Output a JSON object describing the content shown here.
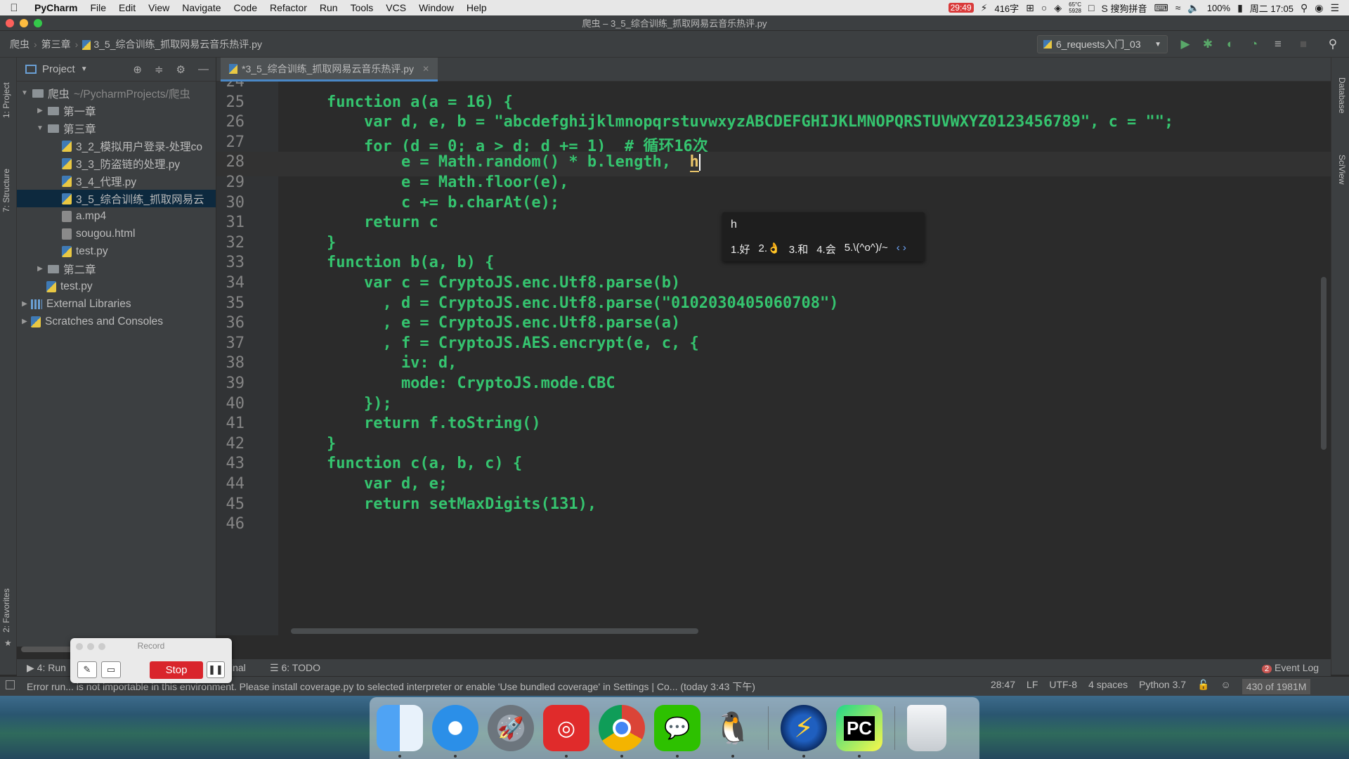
{
  "menubar": {
    "app": "PyCharm",
    "items": [
      "File",
      "Edit",
      "View",
      "Navigate",
      "Code",
      "Refactor",
      "Run",
      "Tools",
      "VCS",
      "Window",
      "Help"
    ],
    "record_time": "29:49",
    "word_count": "416字",
    "temp_top": "65°C",
    "temp_bottom": "5928",
    "ime_name": "搜狗拼音",
    "battery": "100%",
    "clock": "周二 17:05"
  },
  "window": {
    "title": "爬虫 – 3_5_综合训练_抓取网易云音乐热评.py"
  },
  "navbar": {
    "crumbs": [
      "爬虫",
      "第三章",
      "3_5_综合训练_抓取网易云音乐热评.py"
    ],
    "run_config": "6_requests入门_03"
  },
  "left_strip": {
    "project_tab": "1: Project",
    "structure_tab": "7: Structure",
    "favorites_tab": "2: Favorites"
  },
  "right_strip": {
    "database_tab": "Database",
    "sciview_tab": "SciView"
  },
  "project": {
    "header": "Project",
    "tree": [
      {
        "label": "爬虫",
        "extra": "~/PycharmProjects/爬虫",
        "indent": 0,
        "arrow": "▼",
        "type": "folder"
      },
      {
        "label": "第一章",
        "extra": "",
        "indent": 1,
        "arrow": "▶",
        "type": "folder"
      },
      {
        "label": "第三章",
        "extra": "",
        "indent": 1,
        "arrow": "▼",
        "type": "folder"
      },
      {
        "label": "3_2_模拟用户登录-处理co",
        "extra": "",
        "indent": 2,
        "arrow": "",
        "type": "py"
      },
      {
        "label": "3_3_防盗链的处理.py",
        "extra": "",
        "indent": 2,
        "arrow": "",
        "type": "py"
      },
      {
        "label": "3_4_代理.py",
        "extra": "",
        "indent": 2,
        "arrow": "",
        "type": "py"
      },
      {
        "label": "3_5_综合训练_抓取网易云",
        "extra": "",
        "indent": 2,
        "arrow": "",
        "type": "py",
        "selected": true
      },
      {
        "label": "a.mp4",
        "extra": "",
        "indent": 2,
        "arrow": "",
        "type": "file"
      },
      {
        "label": "sougou.html",
        "extra": "",
        "indent": 2,
        "arrow": "",
        "type": "html"
      },
      {
        "label": "test.py",
        "extra": "",
        "indent": 2,
        "arrow": "",
        "type": "py"
      },
      {
        "label": "第二章",
        "extra": "",
        "indent": 1,
        "arrow": "▶",
        "type": "folder"
      },
      {
        "label": "test.py",
        "extra": "",
        "indent": 1,
        "arrow": "",
        "type": "py"
      },
      {
        "label": "External Libraries",
        "extra": "",
        "indent": 0,
        "arrow": "▶",
        "type": "lib"
      },
      {
        "label": "Scratches and Consoles",
        "extra": "",
        "indent": 0,
        "arrow": "▶",
        "type": "scratch"
      }
    ]
  },
  "editor": {
    "tab_label": "*3_5_综合训练_抓取网易云音乐热评.py",
    "first_line_partial": "\"\"\"",
    "lines": [
      {
        "n": "24",
        "text": "\"\"\""
      },
      {
        "n": "25",
        "text": "    function a(a = 16) {"
      },
      {
        "n": "26",
        "text": "        var d, e, b = \"abcdefghijklmnopqrstuvwxyzABCDEFGHIJKLMNOPQRSTUVWXYZ0123456789\", c = \"\";"
      },
      {
        "n": "27",
        "text": "        for (d = 0; a > d; d += 1)  # 循环16次"
      },
      {
        "n": "28",
        "text": "            e = Math.random() * b.length,  "
      },
      {
        "n": "29",
        "text": "            e = Math.floor(e),"
      },
      {
        "n": "30",
        "text": "            c += b.charAt(e);"
      },
      {
        "n": "31",
        "text": "        return c"
      },
      {
        "n": "32",
        "text": "    }"
      },
      {
        "n": "33",
        "text": "    function b(a, b) {"
      },
      {
        "n": "34",
        "text": "        var c = CryptoJS.enc.Utf8.parse(b)"
      },
      {
        "n": "35",
        "text": "          , d = CryptoJS.enc.Utf8.parse(\"0102030405060708\")"
      },
      {
        "n": "36",
        "text": "          , e = CryptoJS.enc.Utf8.parse(a)"
      },
      {
        "n": "37",
        "text": "          , f = CryptoJS.AES.encrypt(e, c, {"
      },
      {
        "n": "38",
        "text": "            iv: d,"
      },
      {
        "n": "39",
        "text": "            mode: CryptoJS.mode.CBC"
      },
      {
        "n": "40",
        "text": "        });"
      },
      {
        "n": "41",
        "text": "        return f.toString()"
      },
      {
        "n": "42",
        "text": "    }"
      },
      {
        "n": "43",
        "text": "    function c(a, b, c) {"
      },
      {
        "n": "44",
        "text": "        var d, e;"
      },
      {
        "n": "45",
        "text": "        return setMaxDigits(131),"
      },
      {
        "n": "46",
        "text": ""
      }
    ],
    "typed_text": "h",
    "current_line": "28"
  },
  "ime_popup": {
    "preedit": "h",
    "candidates": [
      "1.好",
      "2.👌",
      "3.和",
      "4.会",
      "5.\\(^o^)/~"
    ],
    "nav": "‹ ›"
  },
  "bottom_bar": {
    "run_tab": "4: Run",
    "terminal_tab": "inal",
    "todo_tab": "6: TODO",
    "event_log_count": "2",
    "event_log": "Event Log"
  },
  "status": {
    "message": "Error run... is not importable in this environment. Please install coverage.py to selected interpreter or enable 'Use bundled coverage' in Settings | Co... (today 3:43 下午)",
    "position": "28:47",
    "line_sep": "LF",
    "encoding": "UTF-8",
    "indent": "4 spaces",
    "interpreter": "Python 3.7",
    "memory": "430 of 1981M"
  },
  "record_widget": {
    "title": "Record",
    "stop_label": "Stop"
  },
  "dock": {
    "apps": [
      "finder-icon",
      "safari-icon",
      "launchpad-icon",
      "netease-music-icon",
      "chrome-icon",
      "wechat-icon",
      "qq-icon",
      "thunder-icon",
      "pycharm-icon",
      "trash-icon"
    ]
  },
  "colors": {
    "code_green": "#35c46f",
    "stop_red": "#d9252c",
    "selection_blue": "#0d293e",
    "tab_underline": "#4a88c7"
  }
}
